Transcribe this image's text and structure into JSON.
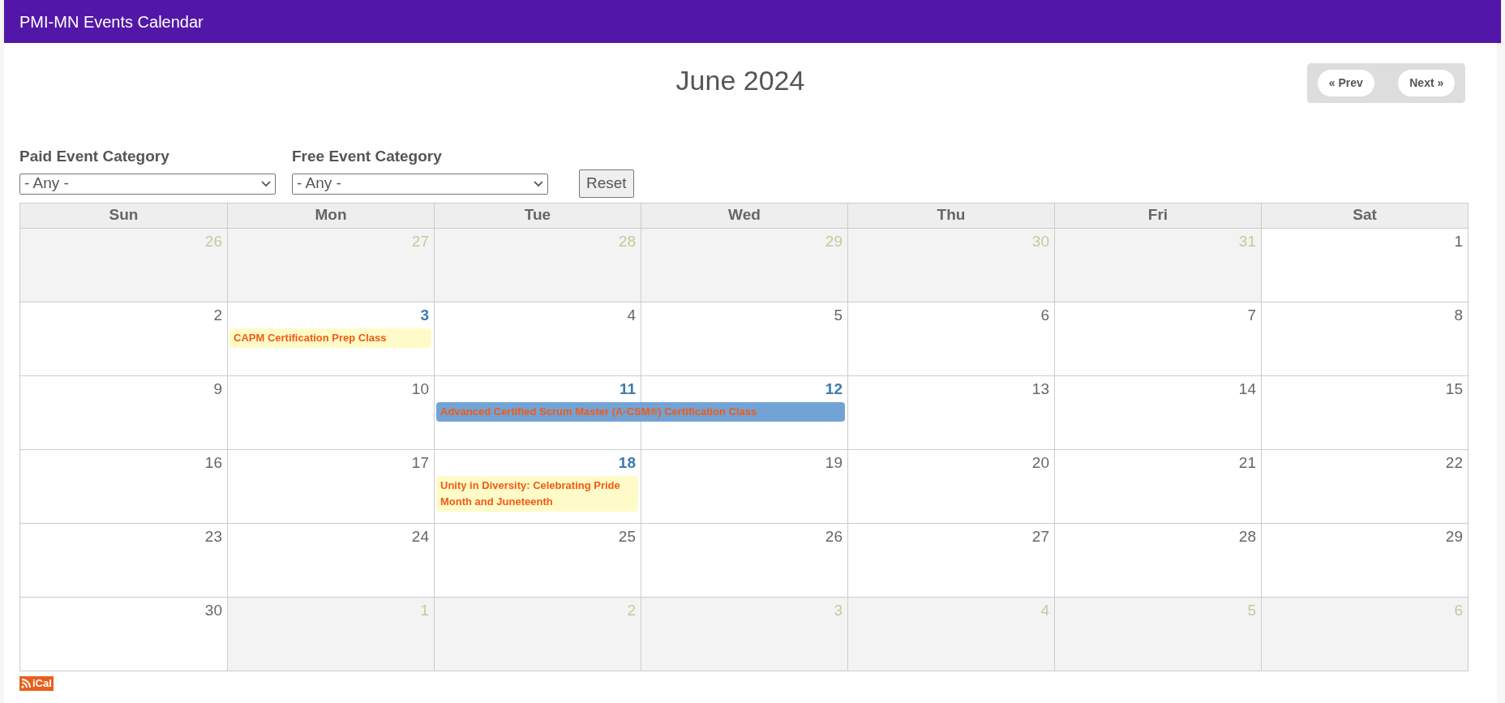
{
  "header": {
    "title": "PMI-MN Events Calendar"
  },
  "calendar": {
    "title": "June 2024",
    "nav": [
      "« Prev",
      "Next »"
    ]
  },
  "filters": [
    {
      "label": "Paid Event Category",
      "value": "- Any -"
    },
    {
      "label": "Free Event Category",
      "value": "- Any -"
    }
  ],
  "reset_button": "Reset",
  "weekdays": [
    "Sun",
    "Mon",
    "Tue",
    "Wed",
    "Thu",
    "Fri",
    "Sat"
  ],
  "weeks": [
    {
      "days": [
        {
          "day": "26",
          "kind": "other"
        },
        {
          "day": "27",
          "kind": "other"
        },
        {
          "day": "28",
          "kind": "other"
        },
        {
          "day": "29",
          "kind": "other"
        },
        {
          "day": "30",
          "kind": "other"
        },
        {
          "day": "31",
          "kind": "other"
        },
        {
          "day": "1",
          "kind": "current"
        }
      ]
    },
    {
      "days": [
        {
          "day": "2",
          "kind": "current"
        },
        {
          "day": "3",
          "kind": "event",
          "event": {
            "label": "CAPM Certification Prep Class",
            "color": "#fffbc8"
          }
        },
        {
          "day": "4",
          "kind": "current"
        },
        {
          "day": "5",
          "kind": "current"
        },
        {
          "day": "6",
          "kind": "current"
        },
        {
          "day": "7",
          "kind": "current"
        },
        {
          "day": "8",
          "kind": "current"
        }
      ]
    },
    {
      "days": [
        {
          "day": "9",
          "kind": "current"
        },
        {
          "day": "10",
          "kind": "current"
        },
        {
          "day": "11",
          "kind": "event",
          "event": {
            "label": "Advanced Certified Scrum Master (A-CSM®) Certification Class",
            "color": "#72a3d5"
          }
        },
        {
          "day": "12",
          "kind": "event",
          "continues_event": true
        },
        {
          "day": "13",
          "kind": "current"
        },
        {
          "day": "14",
          "kind": "current"
        },
        {
          "day": "15",
          "kind": "current"
        }
      ]
    },
    {
      "days": [
        {
          "day": "16",
          "kind": "current"
        },
        {
          "day": "17",
          "kind": "current"
        },
        {
          "day": "18",
          "kind": "event",
          "event": {
            "label": "Unity in Diversity: Celebrating Pride Month and Juneteenth",
            "color": "#fffbc8"
          }
        },
        {
          "day": "19",
          "kind": "current"
        },
        {
          "day": "20",
          "kind": "current"
        },
        {
          "day": "21",
          "kind": "current"
        },
        {
          "day": "22",
          "kind": "current"
        }
      ]
    },
    {
      "days": [
        {
          "day": "23",
          "kind": "current"
        },
        {
          "day": "24",
          "kind": "current"
        },
        {
          "day": "25",
          "kind": "current"
        },
        {
          "day": "26",
          "kind": "current"
        },
        {
          "day": "27",
          "kind": "current"
        },
        {
          "day": "28",
          "kind": "current"
        },
        {
          "day": "29",
          "kind": "current"
        }
      ]
    },
    {
      "days": [
        {
          "day": "30",
          "kind": "current"
        },
        {
          "day": "1",
          "kind": "other"
        },
        {
          "day": "2",
          "kind": "other"
        },
        {
          "day": "3",
          "kind": "other"
        },
        {
          "day": "4",
          "kind": "other"
        },
        {
          "day": "5",
          "kind": "other"
        },
        {
          "day": "6",
          "kind": "other"
        }
      ]
    }
  ],
  "feed_badge": "iCal"
}
